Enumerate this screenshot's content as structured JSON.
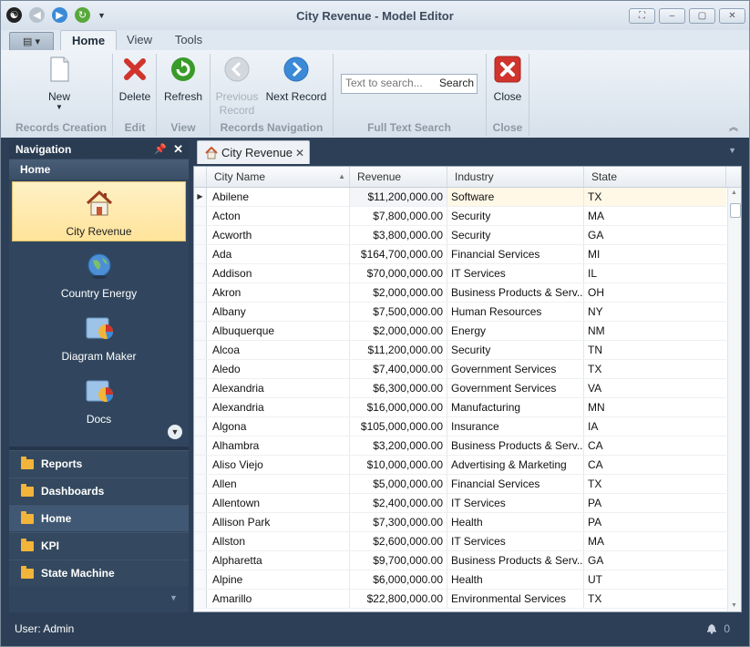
{
  "window": {
    "title": "City Revenue - Model Editor"
  },
  "ribbon_tabs": [
    "Home",
    "View",
    "Tools"
  ],
  "ribbon": {
    "new": "New",
    "delete": "Delete",
    "refresh": "Refresh",
    "previous_record": "Previous Record",
    "next_record": "Next Record",
    "search_placeholder": "Text to search...",
    "search": "Search",
    "close": "Close",
    "groups": {
      "records_creation": "Records Creation",
      "edit": "Edit",
      "view": "View",
      "records_navigation": "Records Navigation",
      "full_text_search": "Full Text Search",
      "close": "Close"
    }
  },
  "navigation": {
    "header": "Navigation",
    "group_title": "Home",
    "items": [
      "City Revenue",
      "Country Energy",
      "Diagram Maker",
      "Docs"
    ],
    "categories": [
      "Reports",
      "Dashboards",
      "Home",
      "KPI",
      "State Machine"
    ]
  },
  "doc_tab": {
    "label": "City Revenue"
  },
  "grid": {
    "columns": [
      "City Name",
      "Revenue",
      "Industry",
      "State"
    ],
    "rows": [
      [
        "Abilene",
        "$11,200,000.00",
        "Software",
        "TX"
      ],
      [
        "Acton",
        "$7,800,000.00",
        "Security",
        "MA"
      ],
      [
        "Acworth",
        "$3,800,000.00",
        "Security",
        "GA"
      ],
      [
        "Ada",
        "$164,700,000.00",
        "Financial Services",
        "MI"
      ],
      [
        "Addison",
        "$70,000,000.00",
        "IT Services",
        "IL"
      ],
      [
        "Akron",
        "$2,000,000.00",
        "Business Products & Serv...",
        "OH"
      ],
      [
        "Albany",
        "$7,500,000.00",
        "Human Resources",
        "NY"
      ],
      [
        "Albuquerque",
        "$2,000,000.00",
        "Energy",
        "NM"
      ],
      [
        "Alcoa",
        "$11,200,000.00",
        "Security",
        "TN"
      ],
      [
        "Aledo",
        "$7,400,000.00",
        "Government Services",
        "TX"
      ],
      [
        "Alexandria",
        "$6,300,000.00",
        "Government Services",
        "VA"
      ],
      [
        "Alexandria",
        "$16,000,000.00",
        "Manufacturing",
        "MN"
      ],
      [
        "Algona",
        "$105,000,000.00",
        "Insurance",
        "IA"
      ],
      [
        "Alhambra",
        "$3,200,000.00",
        "Business Products & Serv...",
        "CA"
      ],
      [
        "Aliso Viejo",
        "$10,000,000.00",
        "Advertising & Marketing",
        "CA"
      ],
      [
        "Allen",
        "$5,000,000.00",
        "Financial Services",
        "TX"
      ],
      [
        "Allentown",
        "$2,400,000.00",
        "IT Services",
        "PA"
      ],
      [
        "Allison Park",
        "$7,300,000.00",
        "Health",
        "PA"
      ],
      [
        "Allston",
        "$2,600,000.00",
        "IT Services",
        "MA"
      ],
      [
        "Alpharetta",
        "$9,700,000.00",
        "Business Products & Serv...",
        "GA"
      ],
      [
        "Alpine",
        "$6,000,000.00",
        "Health",
        "UT"
      ],
      [
        "Amarillo",
        "$22,800,000.00",
        "Environmental Services",
        "TX"
      ]
    ]
  },
  "status": {
    "user": "User: Admin",
    "notifications": "0"
  },
  "icons": {
    "new": "document-icon",
    "delete": "red-x-icon",
    "refresh": "refresh-icon",
    "previous": "arrow-left-icon",
    "next": "arrow-right-icon",
    "close": "close-icon",
    "city_revenue": "house-icon",
    "country_energy": "globe-icon",
    "diagram_maker": "chart-folder-icon",
    "docs": "chart-folder-icon",
    "category": "folder-icon",
    "bell": "bell-icon"
  },
  "colors": {
    "dark_bg": "#2c3f56",
    "selection": "#ffe39a",
    "accent_blue": "#2f7fd0",
    "delete_red": "#d0342c",
    "refresh_green": "#3a9a2a"
  }
}
